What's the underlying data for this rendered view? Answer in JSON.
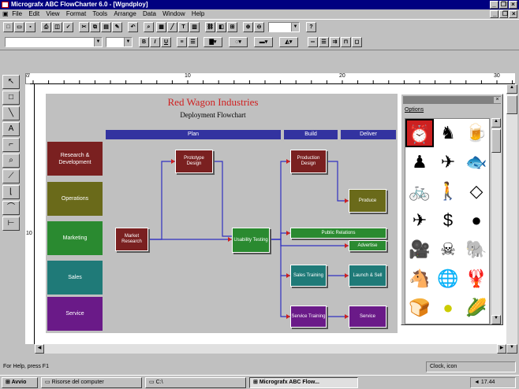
{
  "window": {
    "title": "Micrografx ABC FlowCharter 6.0 - [Wgndploy]",
    "min": "_",
    "max": "❐",
    "close": "×"
  },
  "menu": [
    "File",
    "Edit",
    "View",
    "Format",
    "Tools",
    "Arrange",
    "Data",
    "Window",
    "Help"
  ],
  "toolbar": {
    "zoom_value": "",
    "font_value": "",
    "size_value": ""
  },
  "chart": {
    "title": "Red Wagon Industries",
    "subtitle": "Deployment Flowchart",
    "columns": [
      "Plan",
      "Build",
      "Deliver"
    ],
    "rows": [
      "Research & Development",
      "Operations",
      "Marketing",
      "Sales",
      "Service"
    ],
    "boxes": {
      "prototype": "Prototype Design",
      "production": "Production Design",
      "produce": "Produce",
      "market": "Market Research",
      "usability": "Usability Testing",
      "pr": "Public Relations",
      "advertise": "Advertise",
      "salestrain": "Sales Training",
      "launch": "Launch & Sell",
      "servicetrain": "Service Training",
      "service": "Service"
    },
    "ruler": {
      "h1": "10",
      "h2": "20",
      "h3": "30",
      "v1": "10"
    }
  },
  "palette": {
    "title": "Options",
    "icons": [
      "alarm-clock",
      "horse-head",
      "beer-mug",
      "bowling-pin",
      "fighter-jet",
      "fish",
      "bicycle",
      "hiker",
      "diamond",
      "airplane",
      "money",
      "bomb",
      "movie-camera",
      "skull-crossbones",
      "elephant",
      "donkey",
      "globe",
      "lobster",
      "bread",
      "tennis-ball",
      "corn"
    ]
  },
  "status": {
    "left": "For Help, press F1",
    "right": "Clock, icon"
  },
  "taskbar": {
    "start": "Avvio",
    "task1": "Risorse del computer",
    "task2": "C:\\",
    "task3": "Micrografx ABC Flow...",
    "clock": "17.44"
  }
}
